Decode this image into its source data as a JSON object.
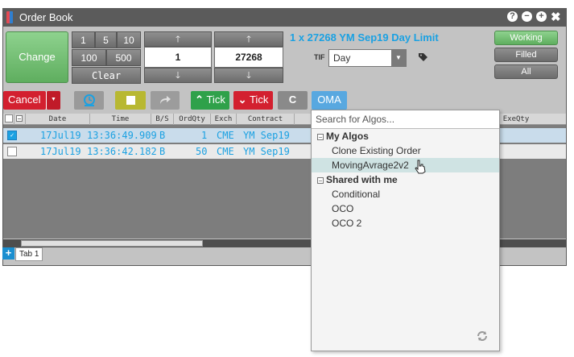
{
  "window": {
    "title": "Order Book",
    "icons": [
      "help-icon",
      "minimize-icon",
      "maximize-icon",
      "close-icon"
    ],
    "help_glyph": "?",
    "min_glyph": "−",
    "max_glyph": "+",
    "close_glyph": "✖"
  },
  "order_entry": {
    "change_label": "Change",
    "qty_presets": [
      "1",
      "5",
      "10",
      "100",
      "500"
    ],
    "clear_label": "Clear",
    "quantity_value": "1",
    "price_value": "27268",
    "up_glyph": "🡑",
    "down_glyph": "🡓",
    "order_summary": "1 x 27268 YM Sep19 Day Limit",
    "tif_label": "TIF",
    "tif_value": "Day",
    "tif_arrow": "▼"
  },
  "filters": {
    "working": "Working",
    "filled": "Filled",
    "all": "All"
  },
  "toolbar": {
    "cancel_label": "Cancel",
    "cancel_arrow": "▼",
    "buy_tick_label": "Tick",
    "sell_tick_label": "Tick",
    "buy_tick_glyph": "⌃",
    "sell_tick_glyph": "⌄",
    "refresh_glyph": "C",
    "oma_label": "OMA"
  },
  "grid": {
    "columns": [
      "Date",
      "Time",
      "B/S",
      "OrdQty",
      "Exch",
      "Contract",
      "ExeQty"
    ],
    "rows": [
      {
        "checked": true,
        "date": "17Jul19",
        "time": "13:36:49.909",
        "bs": "B",
        "ordqty": "1",
        "exch": "CME",
        "contract": "YM Sep19"
      },
      {
        "checked": false,
        "date": "17Jul19",
        "time": "13:36:42.182",
        "bs": "B",
        "ordqty": "50",
        "exch": "CME",
        "contract": "YM Sep19"
      }
    ]
  },
  "tabs": {
    "add_glyph": "+",
    "items": [
      "Tab 1"
    ]
  },
  "algo_menu": {
    "search_placeholder": "Search for Algos...",
    "groups": [
      {
        "label": "My Algos",
        "items": [
          "Clone Existing Order",
          "MovingAvrage2v2"
        ]
      },
      {
        "label": "Shared with me",
        "items": [
          "Conditional",
          "OCO",
          "OCO 2"
        ]
      }
    ],
    "collapse_glyph": "−",
    "hovered_item": "MovingAvrage2v2"
  },
  "colors": {
    "accent_blue": "#1ba1e2",
    "buy_green": "#2fa14a",
    "sell_red": "#d3202f",
    "title_bar": "#5b5b5b"
  }
}
